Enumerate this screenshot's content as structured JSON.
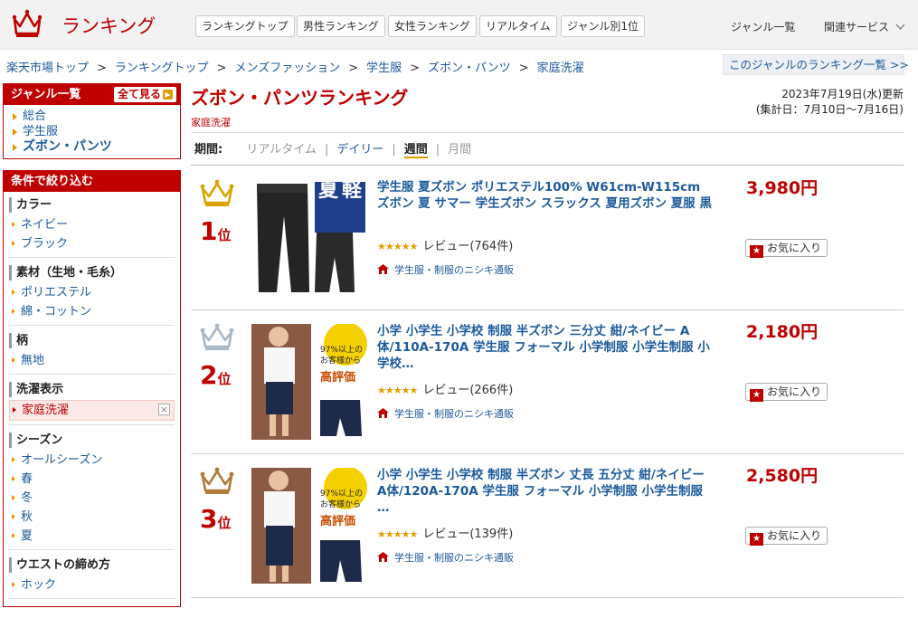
{
  "header": {
    "logo_text": "ランキング",
    "nav_buttons": [
      "ランキングトップ",
      "男性ランキング",
      "女性ランキング",
      "リアルタイム",
      "ジャンル別1位"
    ],
    "genre_list_link": "ジャンル一覧",
    "related_services": "関連サービス"
  },
  "breadcrumb": {
    "items": [
      "楽天市場トップ",
      "ランキングトップ",
      "メンズファッション",
      "学生服",
      "ズボン・パンツ",
      "家庭洗濯"
    ],
    "separator": ">",
    "genre_ranking_link": "このジャンルのランキング一覧 >>"
  },
  "genre_box": {
    "title": "ジャンル一覧",
    "all_button": "全て見る",
    "items": [
      "総合",
      "学生服",
      "ズボン・パンツ"
    ]
  },
  "filter_box": {
    "title": "条件で絞り込む",
    "sections": [
      {
        "heading": "カラー",
        "items": [
          "ネイビー",
          "ブラック"
        ]
      },
      {
        "heading": "素材（生地・毛糸）",
        "items": [
          "ポリエステル",
          "綿・コットン"
        ]
      },
      {
        "heading": "柄",
        "items": [
          "無地"
        ]
      },
      {
        "heading": "洗濯表示",
        "items": [
          "家庭洗濯"
        ],
        "selected": "家庭洗濯"
      },
      {
        "heading": "シーズン",
        "items": [
          "オールシーズン",
          "春",
          "冬",
          "秋",
          "夏"
        ]
      },
      {
        "heading": "ウエストの締め方",
        "items": [
          "ホック"
        ]
      }
    ]
  },
  "main": {
    "title": "ズボン・パンツランキング",
    "subtitle": "家庭洗濯",
    "updated_line1": "2023年7月19日(水)更新",
    "updated_line2": "(集計日：7月10日〜7月16日)",
    "period_label": "期間:",
    "period_options": [
      "リアルタイム",
      "デイリー",
      "週間",
      "月間"
    ],
    "period_selected": "週間"
  },
  "colors": {
    "brand_red": "#bf0000",
    "link_blue": "#1d5a9c",
    "gold": "#d9a400",
    "silver": "#a8b8c4",
    "bronze": "#b07a3a"
  },
  "products": [
    {
      "rank": "1",
      "rank_suffix": "位",
      "crown": "gold-crown-icon",
      "name": "学生服 夏ズボン ポリエステル100% W61cm-W115cm ズボン 夏 サマー 学生ズボン スラックス 夏用ズボン 夏服 黒",
      "review": "レビュー(764件)",
      "rating": 4.5,
      "shop": "学生服・制服のニシキ通販",
      "price": "3,980円",
      "fav_label": "お気に入り",
      "thumb_text": [
        "夏",
        "軽"
      ]
    },
    {
      "rank": "2",
      "rank_suffix": "位",
      "crown": "silver-crown-icon",
      "name": "小学 小学生 小学校 制服 半ズボン 三分丈 紺/ネイビー A体/110A-170A 学生服 フォーマル 小学制服 小学生制服 小学校…",
      "review": "レビュー(266件)",
      "rating": 4.5,
      "shop": "学生服・制服のニシキ通販",
      "price": "2,180円",
      "fav_label": "お気に入り",
      "thumb_text": [
        "97%以上の",
        "お客様から",
        "高評価"
      ]
    },
    {
      "rank": "3",
      "rank_suffix": "位",
      "crown": "bronze-crown-icon",
      "name": "小学 小学生 小学校 制服 半ズボン 丈長 五分丈 紺/ネイビー A体/120A-170A 学生服 フォーマル 小学制服 小学生制服 …",
      "review": "レビュー(139件)",
      "rating": 4.5,
      "shop": "学生服・制服のニシキ通販",
      "price": "2,580円",
      "fav_label": "お気に入り",
      "thumb_text": [
        "97%以上の",
        "お客様から",
        "高評価"
      ]
    }
  ]
}
